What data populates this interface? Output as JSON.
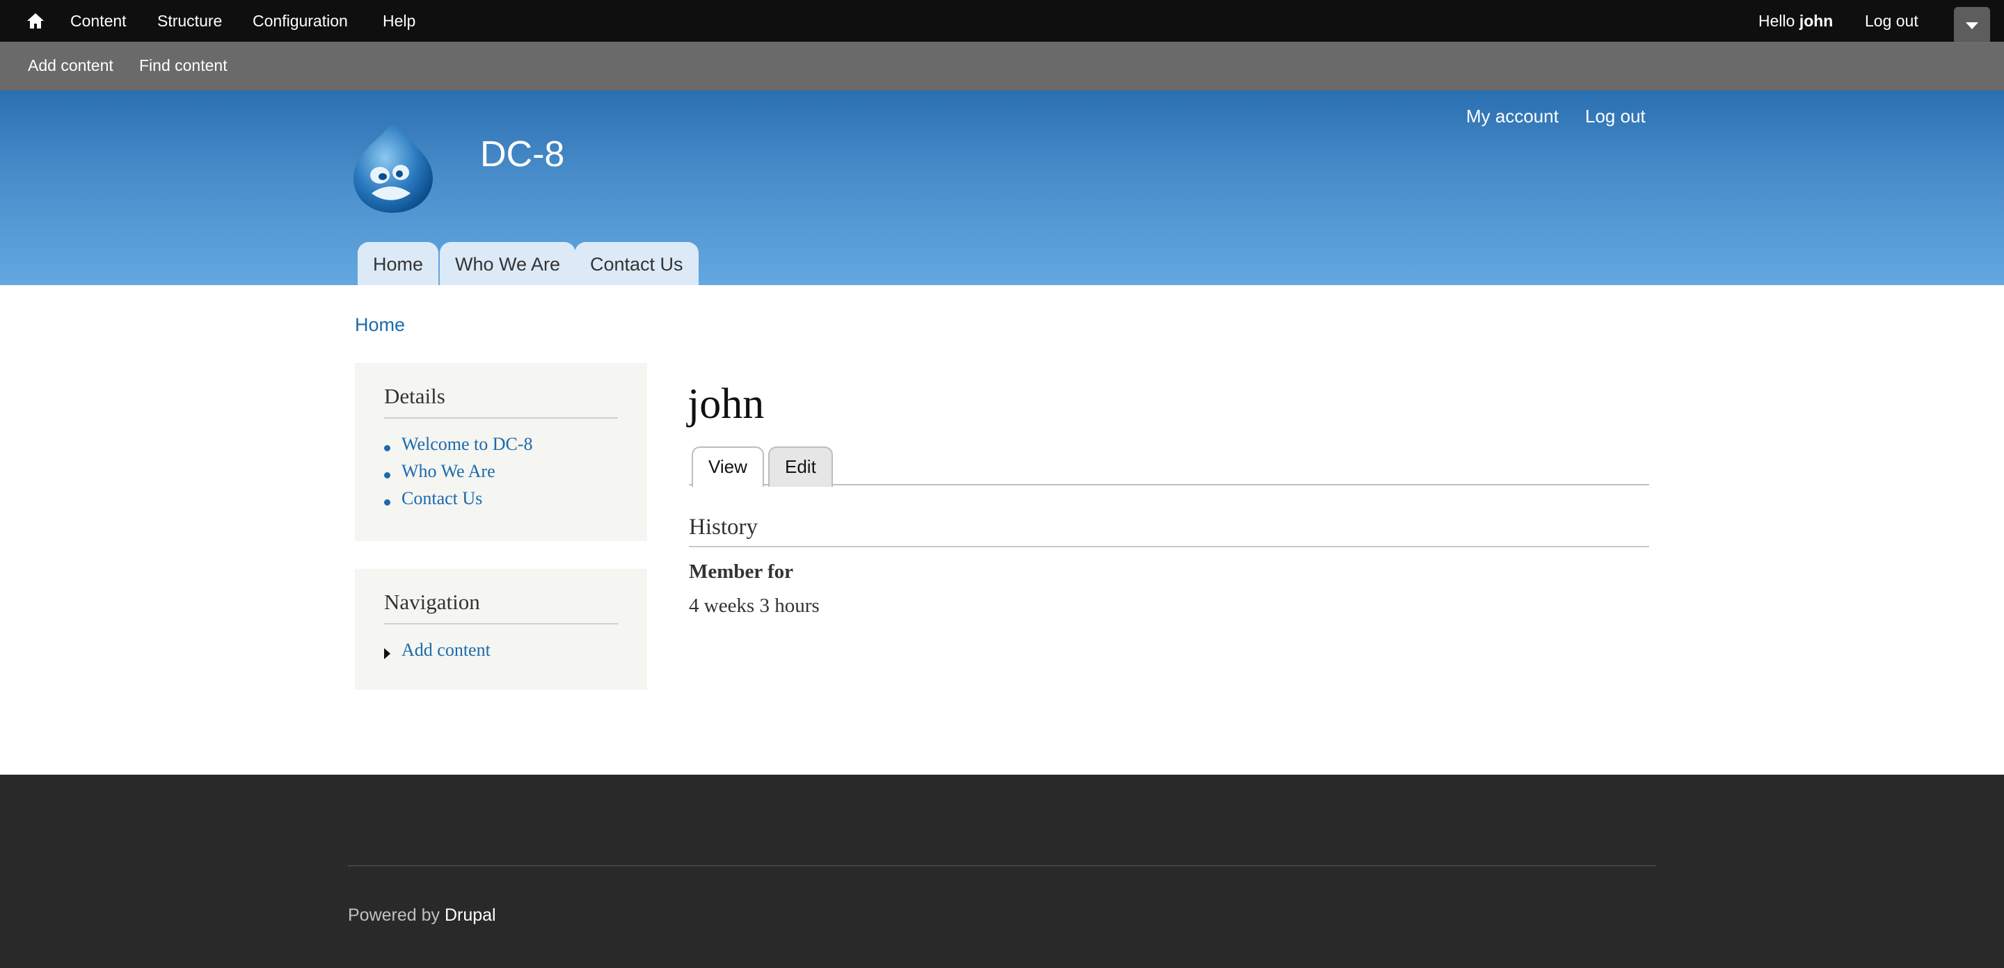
{
  "toolbar": {
    "home_icon": "home-icon",
    "items": [
      {
        "label": "Content"
      },
      {
        "label": "Structure"
      },
      {
        "label": "Configuration"
      },
      {
        "label": "Help"
      }
    ],
    "hello_prefix": "Hello ",
    "user": "john",
    "logout": "Log out",
    "tray": [
      {
        "label": "Add content"
      },
      {
        "label": "Find content"
      }
    ]
  },
  "header": {
    "logo_icon": "drupal-drop-logo",
    "site_name": "DC-8",
    "secondary_menu": [
      {
        "label": "My account"
      },
      {
        "label": "Log out"
      }
    ],
    "main_menu": [
      {
        "label": "Home"
      },
      {
        "label": "Who We Are"
      },
      {
        "label": "Contact Us"
      }
    ]
  },
  "breadcrumb": {
    "home": "Home"
  },
  "sidebar": {
    "details": {
      "title": "Details",
      "links": [
        {
          "label": "Welcome to DC-8"
        },
        {
          "label": "Who We Are"
        },
        {
          "label": "Contact Us"
        }
      ]
    },
    "navigation": {
      "title": "Navigation",
      "links": [
        {
          "label": "Add content"
        }
      ]
    }
  },
  "main": {
    "title": "john",
    "tabs": [
      {
        "label": "View",
        "active": true
      },
      {
        "label": "Edit",
        "active": false
      }
    ],
    "section_title": "History",
    "field_label": "Member for",
    "field_value": "4 weeks 3 hours"
  },
  "footer": {
    "powered_prefix": "Powered by ",
    "powered_link": "Drupal"
  },
  "colors": {
    "toolbar": "#0f0f0f",
    "tray": "#6a6a6a",
    "header_top": "#2a6fb0",
    "header_bottom": "#63a8e0",
    "link": "#1b6aac",
    "footer": "#292929"
  }
}
